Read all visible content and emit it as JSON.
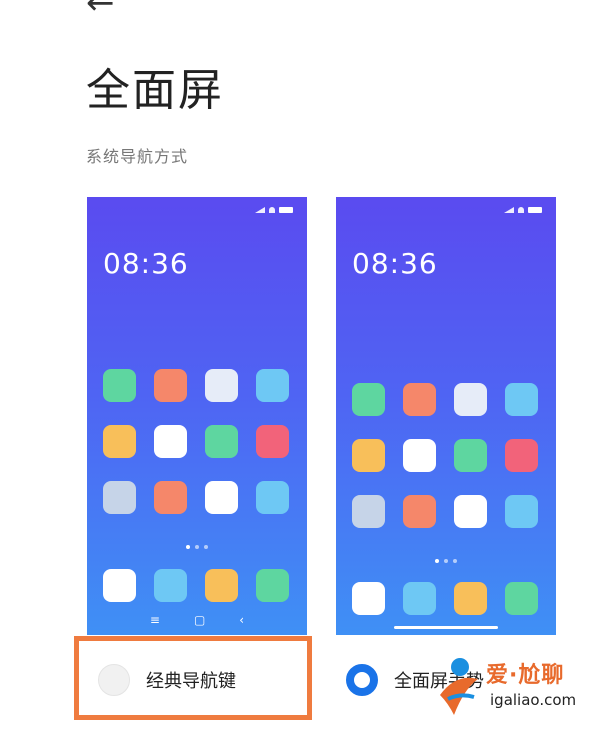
{
  "header": {
    "back_icon": "arrow-left-icon",
    "title": "全面屏"
  },
  "section": {
    "label": "系统导航方式"
  },
  "preview_left": {
    "time": "08:36",
    "app_colors": [
      "#5ed6a0",
      "#f5876a",
      "#e6ecf8",
      "#6ec8f4",
      "#f8bf5a",
      "#ffffff",
      "#5ed6a0",
      "#f2637a",
      "#c6d4e8",
      "#f5876a",
      "#ffffff",
      "#6ec8f4"
    ],
    "dock_colors": [
      "#ffffff",
      "#6ec8f4",
      "#f8bf5a",
      "#5ed6a0"
    ],
    "nav_icons": [
      "menu-icon",
      "home-square-icon",
      "back-chevron-icon"
    ],
    "nav_glyphs": [
      "≡",
      "▢",
      "‹"
    ]
  },
  "preview_right": {
    "time": "08:36",
    "app_colors": [
      "#5ed6a0",
      "#f5876a",
      "#e6ecf8",
      "#6ec8f4",
      "#f8bf5a",
      "#ffffff",
      "#5ed6a0",
      "#f2637a",
      "#c6d4e8",
      "#f5876a",
      "#ffffff",
      "#6ec8f4"
    ],
    "dock_colors": [
      "#ffffff",
      "#6ec8f4",
      "#f8bf5a",
      "#5ed6a0"
    ]
  },
  "options": {
    "classic": {
      "label": "经典导航键",
      "selected": false
    },
    "gesture": {
      "label": "全面屏手势",
      "selected": true
    }
  },
  "colors": {
    "accent": "#1a73e8",
    "highlight_box": "#ef7b3f"
  },
  "watermark": {
    "top_text": "爱·尬聊",
    "bottom_text": "igaliao.com"
  }
}
